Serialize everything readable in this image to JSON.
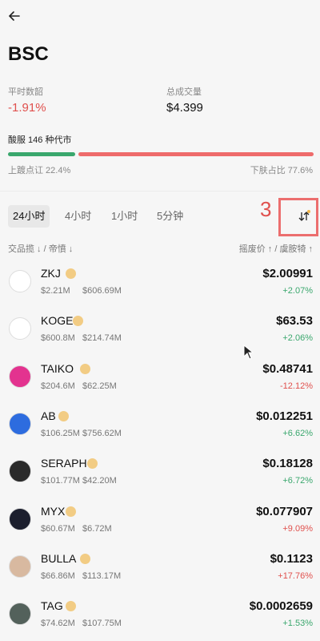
{
  "header": {
    "title": "BSC"
  },
  "stats": {
    "left_label": "平时数韶",
    "left_value": "-1.91%",
    "right_label": "总成交量",
    "right_value": "$4.399"
  },
  "count_text": "酸服 146 种代市",
  "ratio": {
    "left": "上踱点讧 22.4%",
    "right": "下肤占比 77.6%",
    "up_fraction": 0.224,
    "down_fraction": 0.776
  },
  "tabs": [
    "24小时",
    "4小时",
    "1小时",
    "5分钟"
  ],
  "annotation_number": "3",
  "columns": {
    "left": "交品揽 ↓ / 帝憤 ↓",
    "right": "摇废价 ↑ / 虞胺犄 ↑"
  },
  "tokens": [
    {
      "name": "ZKJ",
      "v1": "$2.21M",
      "v2": "$606.69M",
      "price": "$2.00991",
      "change": "+2.07%",
      "up": true,
      "color": "#ffffff"
    },
    {
      "name": "KOGE",
      "v1": "$600.8M",
      "v2": "$214.74M",
      "price": "$63.53",
      "change": "+2.06%",
      "up": true,
      "color": "#ffffff"
    },
    {
      "name": "TAIKO",
      "v1": "$204.6M",
      "v2": "$62.25M",
      "price": "$0.48741",
      "change": "-12.12%",
      "up": false,
      "color": "#e3338f"
    },
    {
      "name": "AB",
      "v1": "$106.25M",
      "v2": "$756.62M",
      "price": "$0.012251",
      "change": "+6.62%",
      "up": true,
      "color": "#2d6cdf"
    },
    {
      "name": "SERAPH",
      "v1": "$101.77M",
      "v2": "$42.20M",
      "price": "$0.18128",
      "change": "+6.72%",
      "up": true,
      "color": "#2a2a2a"
    },
    {
      "name": "MYX",
      "v1": "$60.67M",
      "v2": "$6.72M",
      "price": "$0.077907",
      "change": "+9.09%",
      "up": false,
      "color": "#1c1f2e"
    },
    {
      "name": "BULLA",
      "v1": "$66.86M",
      "v2": "$113.17M",
      "price": "$0.1123",
      "change": "+17.76%",
      "up": false,
      "color": "#d8b9a0"
    },
    {
      "name": "TAG",
      "v1": "$74.62M",
      "v2": "$107.75M",
      "price": "$0.0002659",
      "change": "+1.53%",
      "up": true,
      "color": "#53615b"
    }
  ]
}
